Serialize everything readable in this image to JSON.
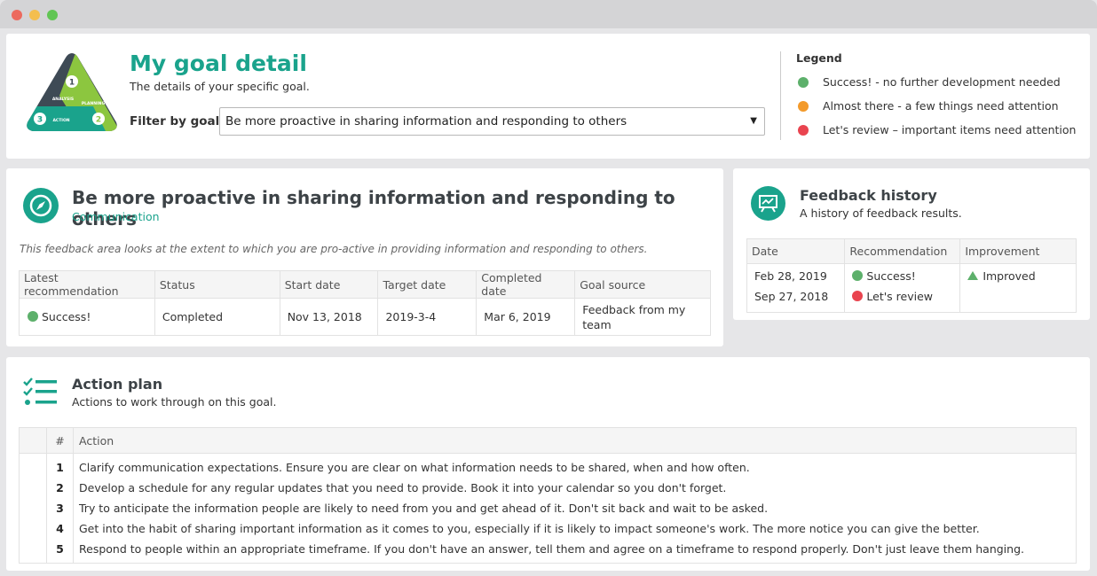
{
  "window": {
    "controls": [
      "close",
      "minimize",
      "maximize"
    ]
  },
  "header": {
    "logo_labels": {
      "step1": "1",
      "step2": "2",
      "step3": "3",
      "analysis": "ANALYSIS",
      "planning": "PLANNING",
      "action": "ACTION"
    },
    "title": "My goal detail",
    "subtitle": "The details of your specific goal.",
    "filter_label": "Filter by goal:",
    "filter_value": "Be more proactive in sharing information and responding to others",
    "legend": {
      "title": "Legend",
      "items": [
        {
          "label": "Success! - no further development needed",
          "color": "#5db06b"
        },
        {
          "label": "Almost there - a few things need attention",
          "color": "#f39a2b"
        },
        {
          "label": "Let's review – important items need attention",
          "color": "#e9444f"
        }
      ]
    }
  },
  "goal": {
    "icon": "compass-icon",
    "title": "Be more proactive in sharing information and responding to others",
    "category": "Communication",
    "description": "This feedback area looks at the extent to which you are pro-active in providing information and responding to others.",
    "columns": [
      "Latest recommendation",
      "Status",
      "Start date",
      "Target date",
      "Completed date",
      "Goal source"
    ],
    "row": {
      "recommendation": "Success!",
      "recommendation_color": "#5db06b",
      "status": "Completed",
      "start_date": "Nov 13, 2018",
      "target_date": "2019-3-4",
      "completed_date": "Mar 6, 2019",
      "goal_source": "Feedback from my team"
    }
  },
  "feedback_history": {
    "icon": "presentation-chart-icon",
    "title": "Feedback history",
    "subtitle": "A history of feedback results.",
    "columns": [
      "Date",
      "Recommendation",
      "Improvement"
    ],
    "rows": [
      {
        "date": "Feb 28, 2019",
        "recommendation": "Success!",
        "color": "#5db06b"
      },
      {
        "date": "Sep 27, 2018",
        "recommendation": "Let's review",
        "color": "#e9444f"
      }
    ],
    "improvement": "Improved",
    "improvement_color": "#5db06b"
  },
  "action_plan": {
    "icon": "checklist-icon",
    "title": "Action plan",
    "subtitle": "Actions to work through on this goal.",
    "columns": [
      "",
      "#",
      "Action"
    ],
    "rows": [
      {
        "num": "1",
        "action": "Clarify communication expectations. Ensure you are clear on what information needs to be shared, when and how often."
      },
      {
        "num": "2",
        "action": "Develop a schedule for any regular updates that you need to provide. Book it into your calendar so you don't forget."
      },
      {
        "num": "3",
        "action": "Try to anticipate the information people are likely to need from you and get ahead of it. Don't sit back and wait to be asked."
      },
      {
        "num": "4",
        "action": "Get into the habit of sharing important information as it comes to you, especially if it is likely to impact someone's work. The more notice you can give the better."
      },
      {
        "num": "5",
        "action": "Respond to people within an appropriate timeframe. If you don't have an answer, tell them and agree on a timeframe to respond properly. Don't just leave them hanging."
      }
    ]
  }
}
